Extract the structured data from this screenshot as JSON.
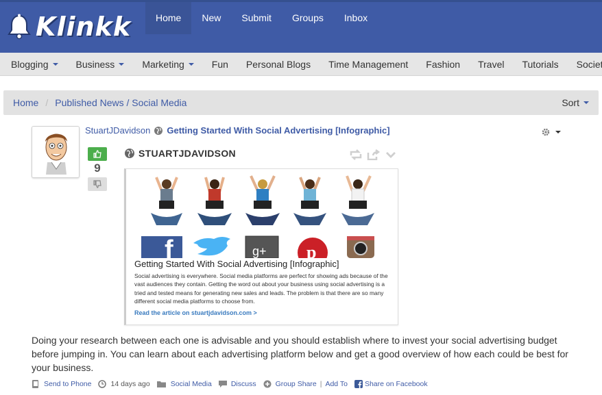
{
  "brand": {
    "name": "Klinkk"
  },
  "topnav": [
    {
      "label": "Home",
      "active": true
    },
    {
      "label": "New"
    },
    {
      "label": "Submit"
    },
    {
      "label": "Groups"
    },
    {
      "label": "Inbox"
    }
  ],
  "categories": [
    {
      "label": "Blogging",
      "dropdown": true
    },
    {
      "label": "Business",
      "dropdown": true
    },
    {
      "label": "Marketing",
      "dropdown": true
    },
    {
      "label": "Fun"
    },
    {
      "label": "Personal Blogs"
    },
    {
      "label": "Time Management"
    },
    {
      "label": "Fashion"
    },
    {
      "label": "Travel"
    },
    {
      "label": "Tutorials"
    },
    {
      "label": "Society"
    }
  ],
  "breadcrumb": {
    "home": "Home",
    "section": "Published News / Social Media",
    "sort_label": "Sort"
  },
  "post": {
    "author": "StuartJDavidson",
    "title": "Getting Started With Social Advertising [Infographic]",
    "votes": "9",
    "source": "STUARTJDAVIDSON",
    "card": {
      "title": "Getting Started With Social Advertising [Infographic]",
      "description": "Social advertising is everywhere. Social media platforms are perfect for showing ads because of the vast audiences they contain. Getting the word out about your business using social advertising is a tried and tested means for generating new sales and leads. The problem is that there are so many different social media platforms to choose from.",
      "link": "Read the article on stuartjdavidson.com >"
    },
    "body": "Doing your research between each one is advisable and you should establish where to invest your social advertising budget before jumping in. You can learn about each advertising platform below and get a good overview of how each could be best for your business."
  },
  "footer": {
    "send_to_phone": "Send to Phone",
    "time_ago": "14 days ago",
    "category": "Social Media",
    "discuss": "Discuss",
    "group_share": "Group Share",
    "add_to": "Add To",
    "share_facebook": "Share on Facebook"
  },
  "colors": {
    "brand_blue": "#3f5ba6",
    "vote_green": "#4cae4c",
    "link_blue": "#3a7bbf"
  }
}
